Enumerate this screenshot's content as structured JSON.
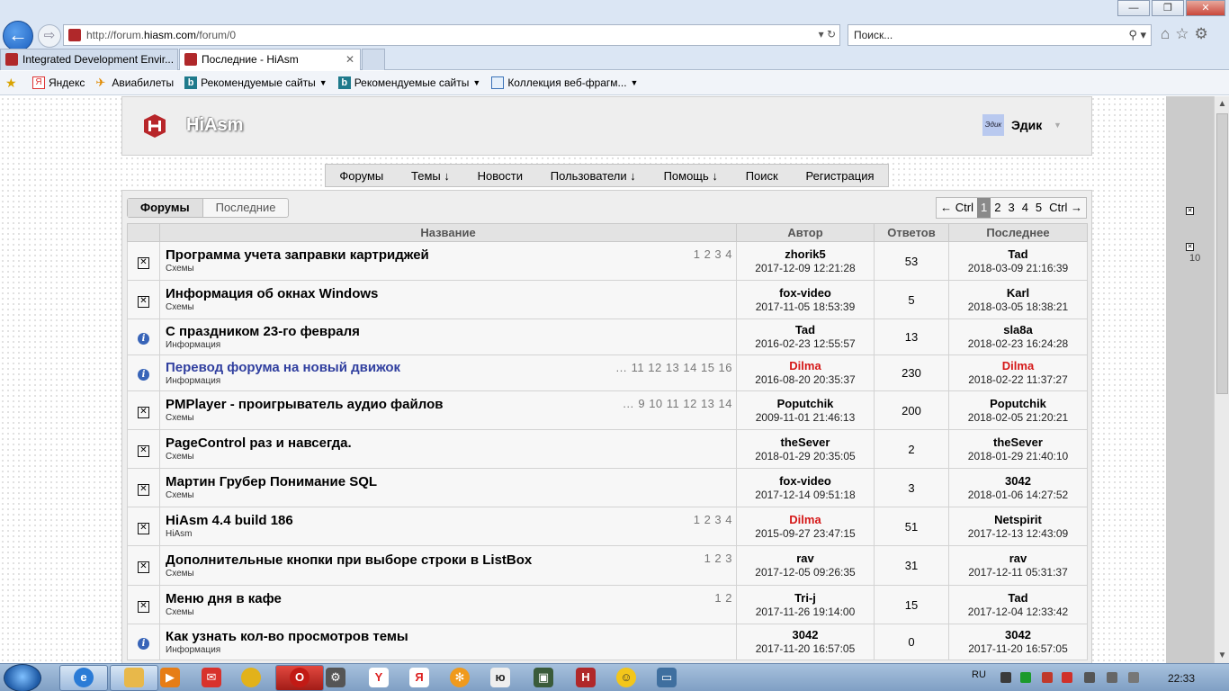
{
  "browser": {
    "url_prefix": "http://forum.",
    "url_domain": "hiasm.com",
    "url_suffix": "/forum/0",
    "search_placeholder": "Поиск...",
    "window_buttons": [
      "—",
      "❐",
      "✕"
    ],
    "tabs": [
      {
        "title": "Integrated Development Envir..."
      },
      {
        "title": "Последние - HiAsm",
        "close": "✕"
      }
    ],
    "favorites": [
      {
        "label": "Яндекс",
        "icon": "yandex-icon"
      },
      {
        "label": "Авиабилеты",
        "icon": "plane-icon"
      },
      {
        "label": "Рекомендуемые сайты",
        "icon": "bing-icon"
      },
      {
        "label": "Рекомендуемые сайты",
        "icon": "bing-icon"
      },
      {
        "label": "Коллекция веб-фрагм...",
        "icon": "webslice-icon"
      }
    ]
  },
  "site": {
    "title": "HiAsm",
    "user": {
      "name": "Эдик",
      "avatar_text": "Эдик"
    }
  },
  "menu": [
    "Форумы",
    "Темы ↓",
    "Новости",
    "Пользователи ↓",
    "Помощь ↓",
    "Поиск",
    "Регистрация"
  ],
  "subtabs": [
    "Форумы",
    "Последние"
  ],
  "pager": {
    "prev": "← Ctrl",
    "pages": [
      "1",
      "2",
      "3",
      "4",
      "5"
    ],
    "active": "1",
    "next": "Ctrl →"
  },
  "side_count": "10",
  "columns": {
    "title": "Название",
    "author": "Автор",
    "replies": "Ответов",
    "last": "Последнее"
  },
  "topics": [
    {
      "icon": "box",
      "title": "Программа учета заправки картриджей",
      "category": "Схемы",
      "pages": "1 2 3 4",
      "author": "zhorik5",
      "author_date": "2017-12-09 12:21:28",
      "replies": "53",
      "last": "Tad",
      "last_date": "2018-03-09 21:16:39"
    },
    {
      "icon": "box",
      "title": "Информация об окнах Windows",
      "category": "Схемы",
      "pages": "",
      "author": "fox-video",
      "author_date": "2017-11-05 18:53:39",
      "replies": "5",
      "last": "Karl",
      "last_date": "2018-03-05 18:38:21"
    },
    {
      "icon": "info",
      "title": "С праздником 23-го февраля",
      "category": "Информация",
      "pages": "",
      "author": "Tad",
      "author_date": "2016-02-23 12:55:57",
      "replies": "13",
      "last": "sla8a",
      "last_date": "2018-02-23 16:24:28"
    },
    {
      "icon": "info",
      "title": "Перевод форума на новый движок",
      "category": "Информация",
      "pages": "… 11 12 13 14 15 16",
      "author": "Dilma",
      "author_date": "2016-08-20 20:35:37",
      "replies": "230",
      "last": "Dilma",
      "last_date": "2018-02-22 11:37:27",
      "link": true,
      "author_red": true,
      "last_red": true
    },
    {
      "icon": "box",
      "title": "PMPlayer - проигрыватель аудио файлов",
      "category": "Схемы",
      "pages": "… 9 10 11 12 13 14",
      "author": "Poputchik",
      "author_date": "2009-11-01 21:46:13",
      "replies": "200",
      "last": "Poputchik",
      "last_date": "2018-02-05 21:20:21"
    },
    {
      "icon": "box",
      "title": "PageControl раз и навсегда.",
      "category": "Схемы",
      "pages": "",
      "author": "theSever",
      "author_date": "2018-01-29 20:35:05",
      "replies": "2",
      "last": "theSever",
      "last_date": "2018-01-29 21:40:10"
    },
    {
      "icon": "box",
      "title": "Мартин Грубер Понимание SQL",
      "category": "Схемы",
      "pages": "",
      "author": "fox-video",
      "author_date": "2017-12-14 09:51:18",
      "replies": "3",
      "last": "3042",
      "last_date": "2018-01-06 14:27:52"
    },
    {
      "icon": "box",
      "title": "HiAsm 4.4 build 186",
      "category": "HiAsm",
      "pages": "1 2 3 4",
      "author": "Dilma",
      "author_date": "2015-09-27 23:47:15",
      "replies": "51",
      "last": "Netspirit",
      "last_date": "2017-12-13 12:43:09",
      "author_red": true
    },
    {
      "icon": "box",
      "title": "Дополнительные кнопки при выборе строки в ListBox",
      "category": "Схемы",
      "pages": "1 2 3",
      "author": "rav",
      "author_date": "2017-12-05 09:26:35",
      "replies": "31",
      "last": "rav",
      "last_date": "2017-12-11 05:31:37"
    },
    {
      "icon": "box",
      "title": "Меню дня в кафе",
      "category": "Схемы",
      "pages": "1 2",
      "author": "Tri-j",
      "author_date": "2017-11-26 19:14:00",
      "replies": "15",
      "last": "Tad",
      "last_date": "2017-12-04 12:33:42"
    },
    {
      "icon": "info",
      "title": "Как узнать кол-во просмотров темы",
      "category": "Информация",
      "pages": "",
      "author": "3042",
      "author_date": "2017-11-20 16:57:05",
      "replies": "0",
      "last": "3042",
      "last_date": "2017-11-20 16:57:05"
    }
  ],
  "taskbar": {
    "language": "RU",
    "time": "22:33"
  }
}
